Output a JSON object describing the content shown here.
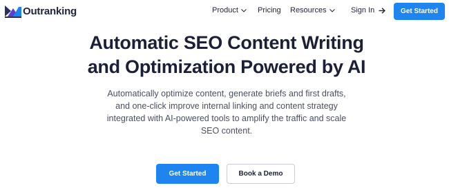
{
  "header": {
    "brand": "Outranking",
    "nav": [
      {
        "label": "Product",
        "has_dropdown": true
      },
      {
        "label": "Pricing",
        "has_dropdown": false
      },
      {
        "label": "Resources",
        "has_dropdown": true
      }
    ],
    "signin": {
      "label": "Sign In",
      "icon": "arrow-right-icon"
    },
    "cta": "Get Started"
  },
  "hero": {
    "title_lines": [
      "Automatic SEO Content Writing",
      "and Optimization Powered by AI"
    ],
    "subtitle_lines": [
      "Automatically optimize content, generate briefs and first drafts,",
      "and one-click improve internal linking and content strategy",
      "integrated with AI-powered tools to amplify the traffic and scale",
      "SEO content."
    ],
    "primary_cta": "Get Started",
    "secondary_cta": "Book a Demo"
  },
  "colors": {
    "accent": "#1e85f0",
    "text_dark": "#1c1f36",
    "text_body": "#4b4f62",
    "logo_dark": "#2b2f5c",
    "logo_blue": "#1e85f0",
    "logo_purple": "#5b3fd1"
  }
}
